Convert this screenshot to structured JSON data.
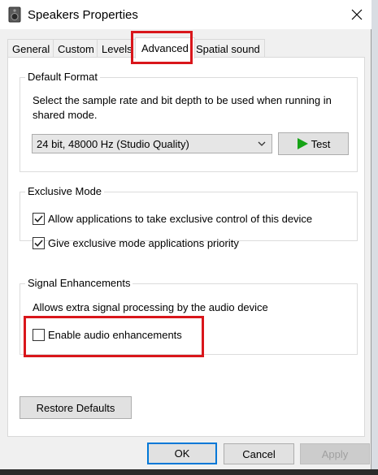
{
  "window": {
    "title": "Speakers Properties",
    "close_glyph": "✕"
  },
  "tabs": [
    {
      "label": "General"
    },
    {
      "label": "Custom"
    },
    {
      "label": "Levels"
    },
    {
      "label": "Advanced",
      "active": true
    },
    {
      "label": "Spatial sound"
    }
  ],
  "default_format": {
    "title": "Default Format",
    "description": "Select the sample rate and bit depth to be used when running in shared mode.",
    "selected_format": "24 bit, 48000 Hz (Studio Quality)",
    "test_label": "Test"
  },
  "exclusive_mode": {
    "title": "Exclusive Mode",
    "options": [
      {
        "label": "Allow applications to take exclusive control of this device",
        "checked": true
      },
      {
        "label": "Give exclusive mode applications priority",
        "checked": true
      }
    ]
  },
  "signal_enhancements": {
    "title": "Signal Enhancements",
    "description": "Allows extra signal processing by the audio device",
    "option": {
      "label": "Enable audio enhancements",
      "checked": false
    }
  },
  "restore_defaults_label": "Restore Defaults",
  "footer": {
    "ok_label": "OK",
    "cancel_label": "Cancel",
    "apply_label": "Apply"
  },
  "colors": {
    "highlight": "#d9161b",
    "accent": "#0078d7",
    "play_green": "#16a316"
  }
}
